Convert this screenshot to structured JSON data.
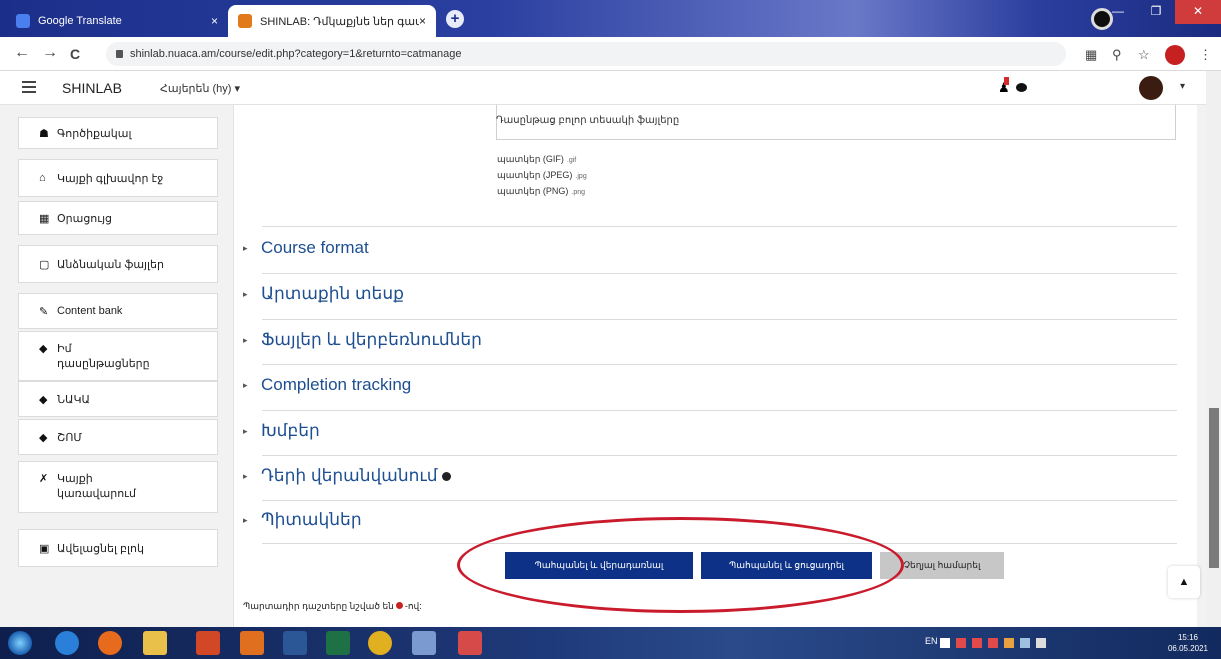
{
  "browser": {
    "tabs": [
      {
        "title": "Google Translate",
        "close": "×"
      },
      {
        "title": "SHINLAB: Դմկաքյնե ներ գաալ",
        "close": "×"
      }
    ],
    "new_tab": "+",
    "url": "shinlab.nuaca.am/course/edit.php?category=1&returnto=catmanage",
    "nav": {
      "back": "←",
      "forward": "→",
      "reload": "C"
    },
    "window_controls": {
      "minimize": "—",
      "maximize": "❐",
      "close": "✕"
    }
  },
  "navbar": {
    "brand": "SHINLAB",
    "language": "Հայերեն (hy) ▾",
    "user_caret": "▾"
  },
  "sidebar": {
    "items": [
      {
        "icon": "dashboard-icon",
        "glyph": "☗",
        "label": "Գործիքակալ"
      },
      {
        "icon": "home-icon",
        "glyph": "⌂",
        "label": "Կայքի գլխավոր էջ"
      },
      {
        "icon": "calendar-icon",
        "glyph": "▦",
        "label": "Օրացույց"
      },
      {
        "icon": "file-icon",
        "glyph": "▢",
        "label": "Անձնական ֆայլեր"
      },
      {
        "icon": "pencil-icon",
        "glyph": "✎",
        "label": "Content bank"
      },
      {
        "icon": "graduation-cap-icon",
        "glyph": "◆",
        "label": "Իմ դասընթացները",
        "double": true
      },
      {
        "icon": "graduation-cap-icon",
        "glyph": "◆",
        "label": "ՆԱԿԱ"
      },
      {
        "icon": "graduation-cap-icon",
        "glyph": "◆",
        "label": "ՇՈՄ"
      },
      {
        "icon": "wrench-icon",
        "glyph": "✗",
        "label": "Կայքի կառավարում",
        "double": true
      },
      {
        "icon": "plus-square-icon",
        "glyph": "▣",
        "label": "Ավելացնել բլոկ"
      }
    ]
  },
  "files": {
    "header": "Դասընթաց բոլոր տեսակի ֆայլերը",
    "types": [
      {
        "label": "պատկեր (GIF)",
        "ext": ".gif"
      },
      {
        "label": "պատկեր (JPEG)",
        "ext": ".jpg"
      },
      {
        "label": "պատկեր (PNG)",
        "ext": ".png"
      }
    ]
  },
  "sections": [
    {
      "title": "Course format"
    },
    {
      "title": "Արտաքին տեսք"
    },
    {
      "title": "Ֆայլեր և վերբեռնումներ"
    },
    {
      "title": "Completion tracking"
    },
    {
      "title": "Խմբեր"
    },
    {
      "title": "Դերի վերանվանում"
    },
    {
      "title": "Պիտակներ"
    }
  ],
  "buttons": {
    "save_return": "Պահպանել և վերադառնալ",
    "save_display": "Պահպանել և ցուցադրել",
    "cancel": "Չեղյալ համարել"
  },
  "required_note": {
    "before": "Պարտադիր դաշտերը նշված են",
    "after": "-ով:"
  },
  "back_to_top": "▲",
  "taskbar": {
    "lang": "EN",
    "clock_time": "15:16",
    "clock_date": "06.05.2021"
  },
  "colors": {
    "section_title": "#1d4f91",
    "primary_button": "#0d3187",
    "annotation": "#c91b2c"
  }
}
